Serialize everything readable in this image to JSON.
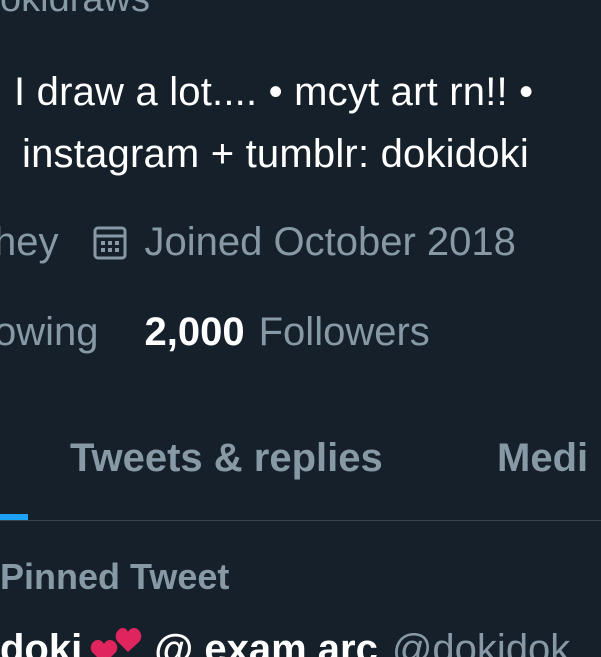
{
  "profile": {
    "handle_fragment": "okidraws",
    "bio_line1": "I draw a lot.... • mcyt art rn!! •",
    "bio_line2": "instagram + tumblr: dokidoki",
    "location_fragment": "hey",
    "joined": "Joined October 2018",
    "following_label": "owing",
    "followers_count": "2,000",
    "followers_label": "Followers"
  },
  "tabs": [
    {
      "label": "Tweets & replies"
    },
    {
      "label": "Medi"
    }
  ],
  "pinned_label": "Pinned Tweet",
  "tweet": {
    "author_name_part1": "doki",
    "author_name_part2": "@ exam arc",
    "author_handle": "@dokidok"
  },
  "colors": {
    "background": "#15202b",
    "text_primary": "#ffffff",
    "text_secondary": "#8899a6",
    "accent": "#1da1f2",
    "divider": "#38444d",
    "heart": "#e0245e"
  },
  "icons": {
    "calendar": "calendar-icon",
    "hearts": "two-hearts-emoji"
  }
}
